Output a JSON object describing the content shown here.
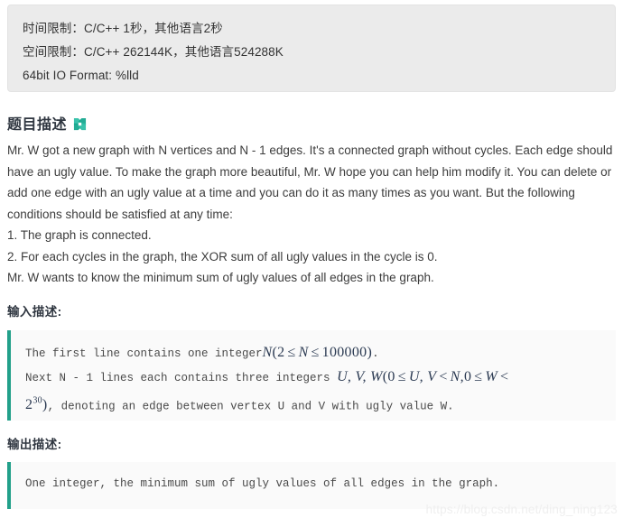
{
  "limits": {
    "lines": [
      "时间限制：C/C++ 1秒，其他语言2秒",
      "空间限制：C/C++ 262144K，其他语言524288K",
      "64bit IO Format: %lld"
    ]
  },
  "description": {
    "heading": "题目描述",
    "heading_icon": "expand-arrows-x-icon",
    "icon_color": "#2fbfa6",
    "paragraphs": [
      "Mr. W got a new graph with N vertices and N - 1 edges. It's a connected graph without cycles. Each edge should have an ugly value. To make the graph more beautiful, Mr. W hope you can help him modify it. You can delete or add one edge with an ugly value at a time and you can do it as many times as you want. But the following conditions should be satisfied at any time:",
      "1. The graph is connected.",
      "2. For each cycles in the graph, the XOR sum of all ugly values in the cycle is 0.",
      "Mr. W wants to know the minimum sum of ugly values of all edges in the graph."
    ]
  },
  "input_section": {
    "heading": "输入描述:",
    "line1_prefix": "The first line contains one integer",
    "line1_math": {
      "var": "N",
      "open": "(",
      "lower": "2",
      "rel1": "≤",
      "mid": "N",
      "rel2": "≤",
      "upper": "100000",
      "close": ")"
    },
    "line1_suffix": ".",
    "line2_prefix": "Next N - 1 lines each contains three integers ",
    "line2_math": {
      "vars": "U, V, W",
      "open": "(",
      "a": "0",
      "rel1": "≤",
      "b": "U, V",
      "rel2": "<",
      "c": "N,",
      "d": "0",
      "rel3": "≤",
      "e": "W",
      "rel4": "<"
    },
    "line3_math": {
      "base": "2",
      "exp": "30",
      "close": ")"
    },
    "line3_suffix": ", denoting an edge between vertex U and V with ugly value W."
  },
  "output_section": {
    "heading": "输出描述:",
    "line1": "One integer, the minimum sum of ugly values of all edges in the graph."
  },
  "watermark": {
    "text": "https://blog.csdn.net/ding_ning123"
  },
  "colors": {
    "accent_teal": "#22a08a",
    "panel_bg": "#ebebeb",
    "code_bg": "#fafafa",
    "heading": "#2f3640"
  }
}
